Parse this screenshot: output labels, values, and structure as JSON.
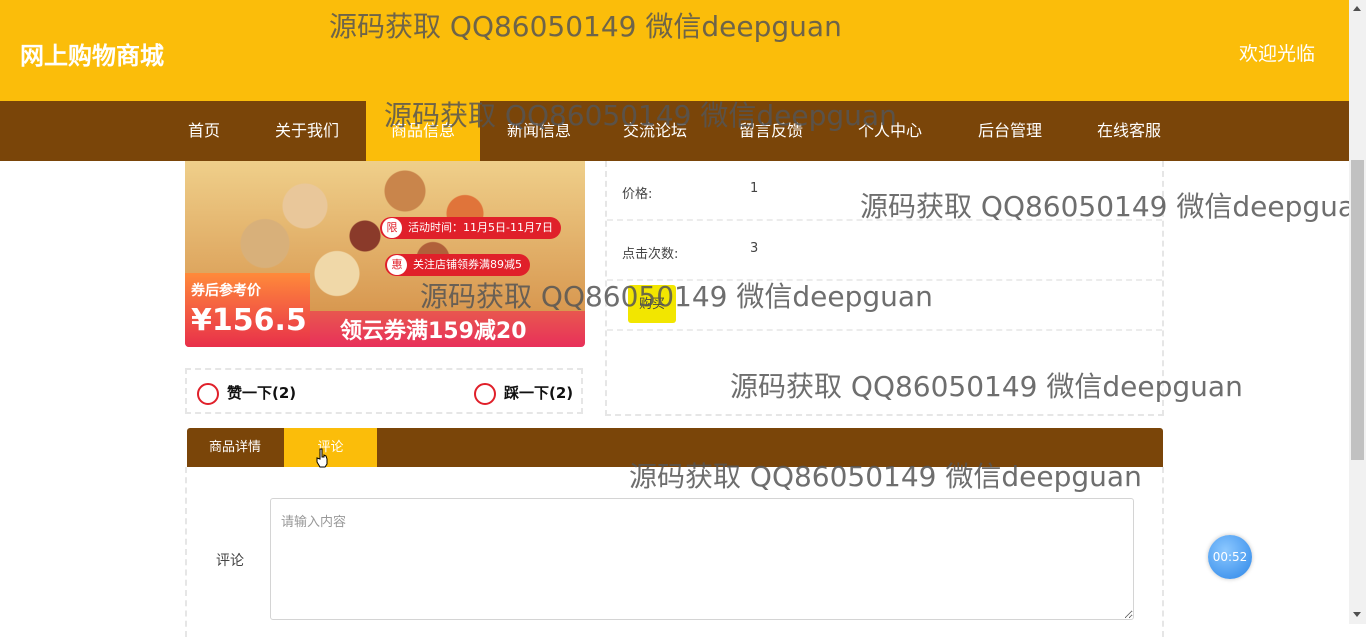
{
  "header": {
    "site_title": "网上购物商城",
    "welcome": "欢迎光临"
  },
  "nav": {
    "items": [
      "首页",
      "关于我们",
      "商品信息",
      "新闻信息",
      "交流论坛",
      "留言反馈",
      "个人中心",
      "后台管理",
      "在线客服"
    ],
    "active_index": 2
  },
  "product_image": {
    "promo_1_badge": "限",
    "promo_1": "活动时间：11月5日-11月7日",
    "promo_2_badge": "惠",
    "promo_2": "关注店铺领券满89减5",
    "price_label": "券后参考价",
    "price_value": "¥156.5",
    "coupon": "领云券满159减20"
  },
  "likes": {
    "like_label": "赞一下(2)",
    "dislike_label": "踩一下(2)"
  },
  "details": {
    "price_label": "价格:",
    "price_value": "1",
    "clicks_label": "点击次数:",
    "clicks_value": "3",
    "buy_label": "购买"
  },
  "tabs": {
    "items": [
      "商品详情",
      "评论"
    ],
    "active_index": 1
  },
  "comment": {
    "label": "评论",
    "placeholder": "请输入内容"
  },
  "timer": "00:52",
  "watermark": "源码获取 QQ86050149 微信deepguan",
  "colors": {
    "header": "#fbbd0a",
    "nav": "#7a4509",
    "buy": "#f2e600"
  }
}
